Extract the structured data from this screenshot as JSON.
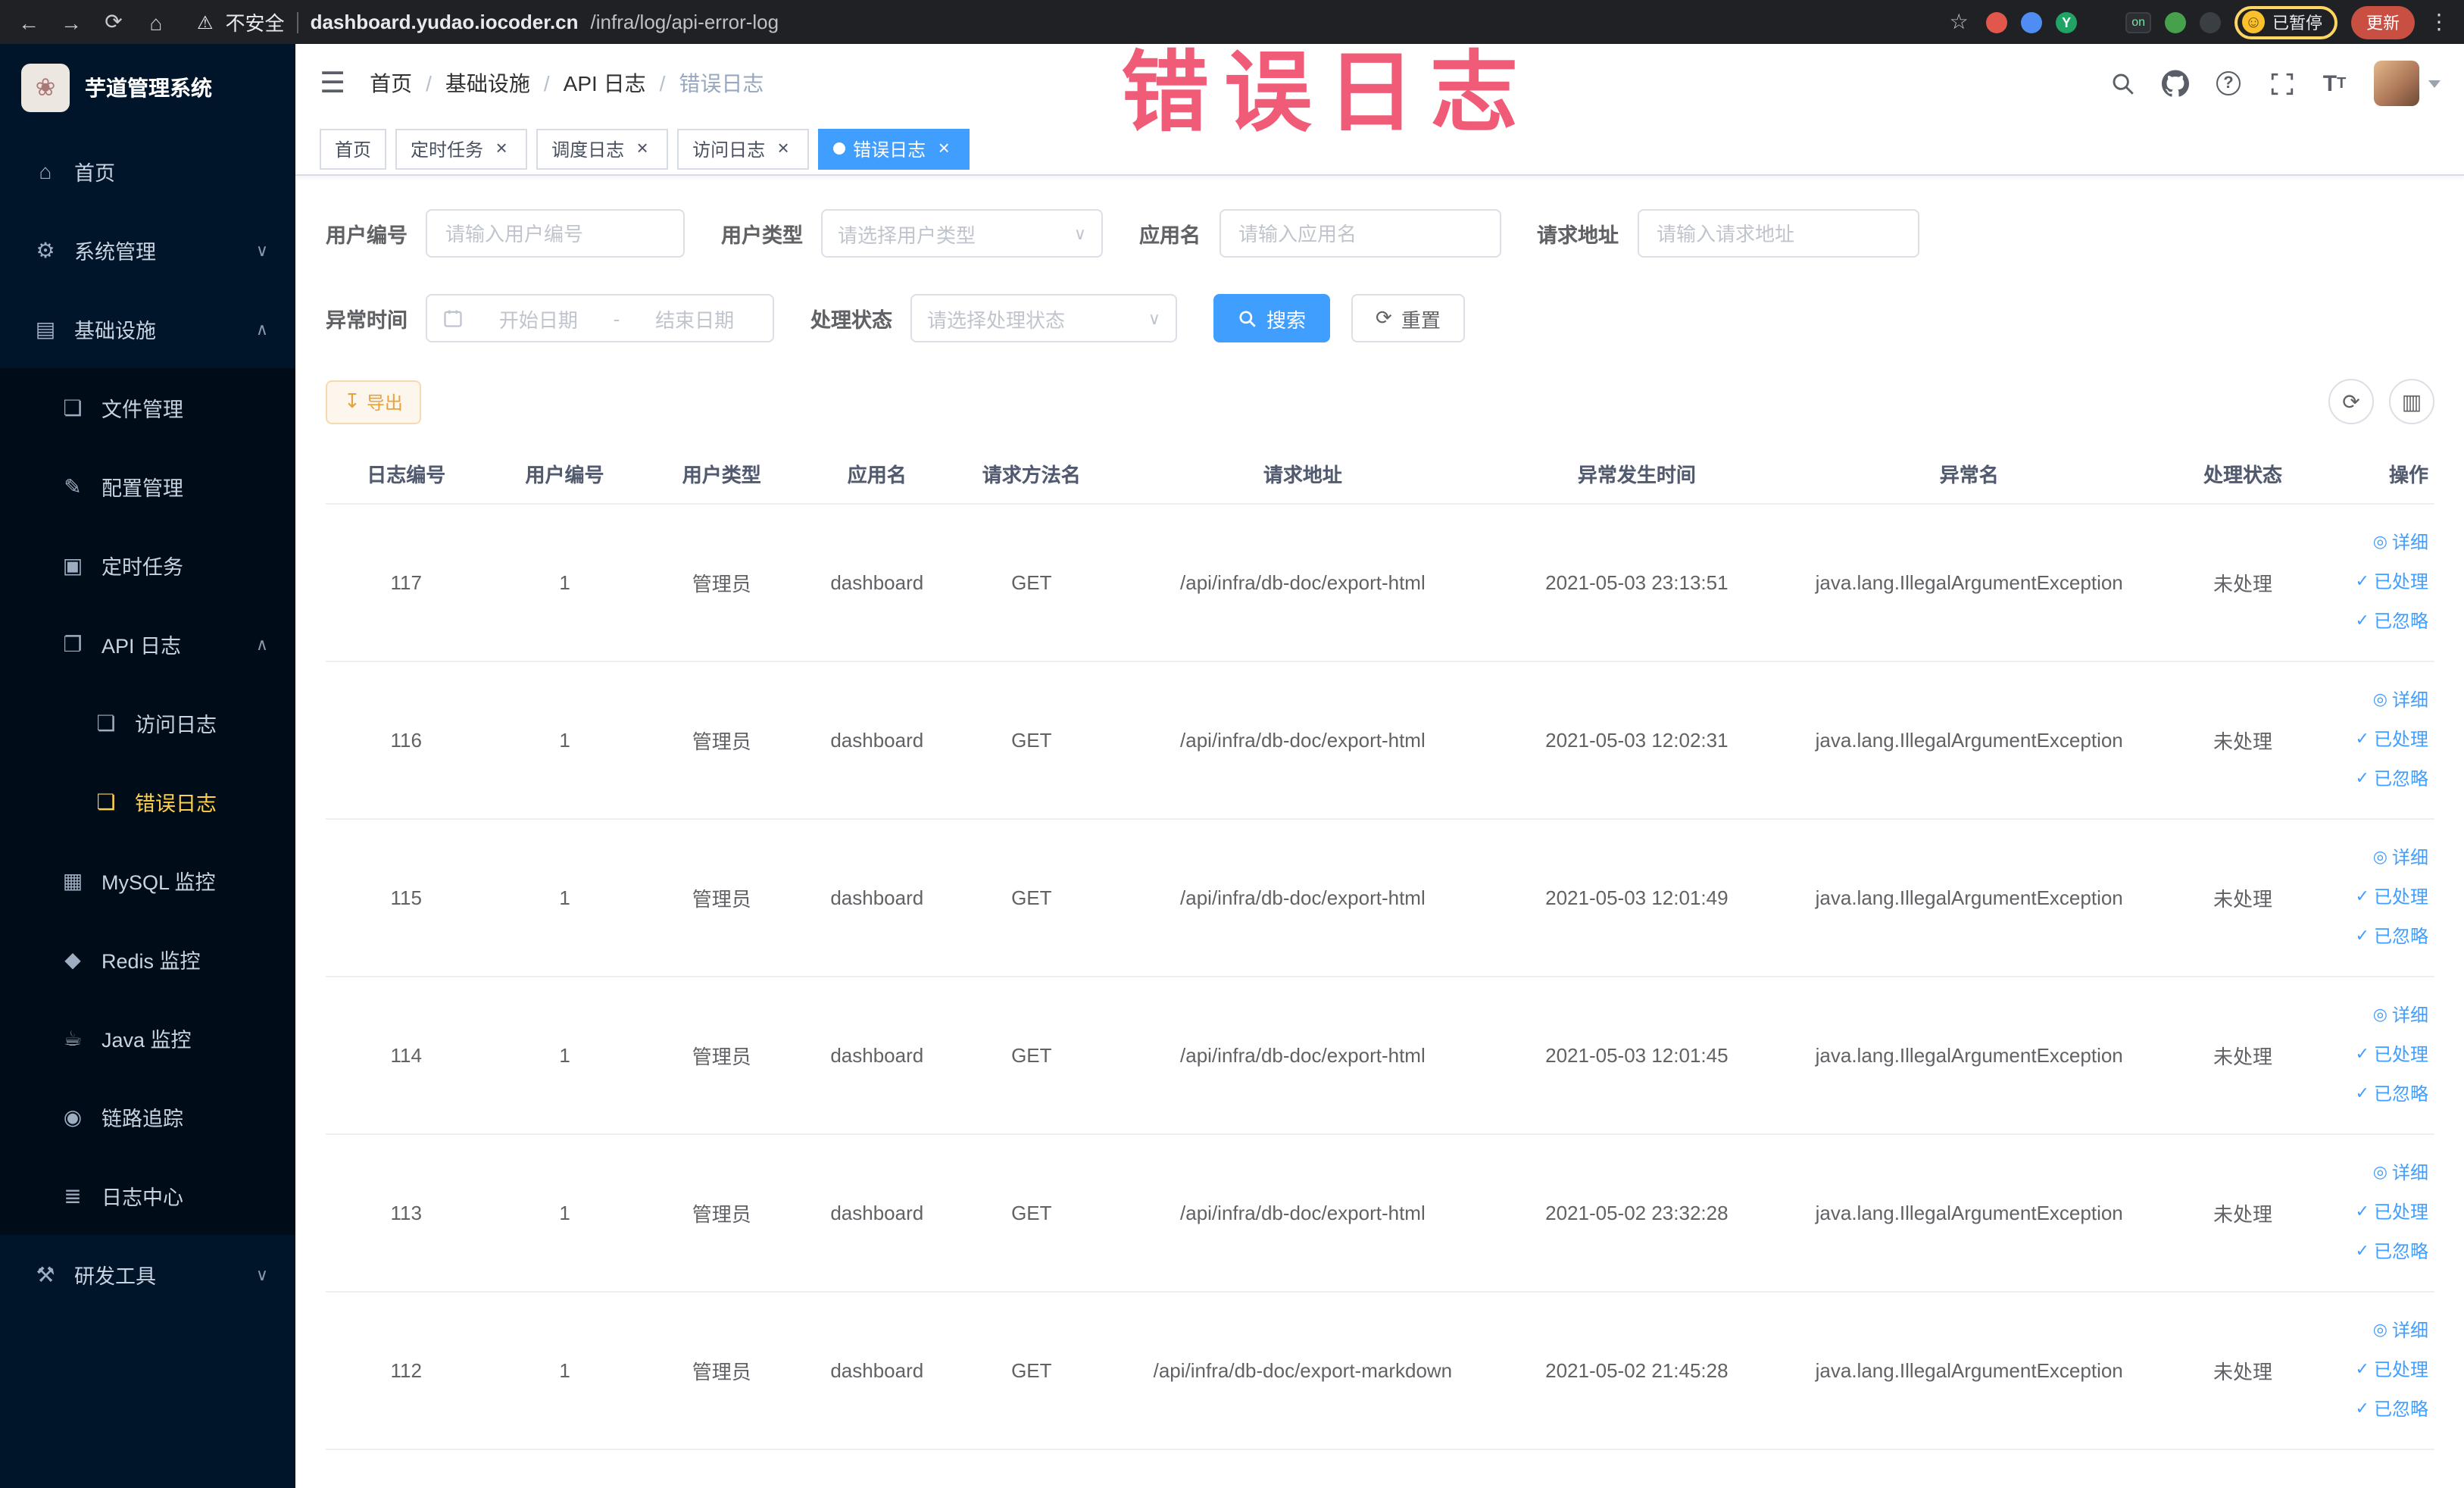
{
  "browser": {
    "security_label": "不安全",
    "url_domain": "dashboard.yudao.iocoder.cn",
    "url_path": "/infra/log/api-error-log",
    "ext_on_badge": "on",
    "profile_badge": "已暂停",
    "update_button": "更新"
  },
  "annotation": {
    "text": "错误日志"
  },
  "sidebar": {
    "logo_title": "芋道管理系统",
    "items": [
      {
        "label": "首页"
      },
      {
        "label": "系统管理"
      },
      {
        "label": "基础设施"
      },
      {
        "label": "文件管理"
      },
      {
        "label": "配置管理"
      },
      {
        "label": "定时任务"
      },
      {
        "label": "API 日志"
      },
      {
        "label": "访问日志"
      },
      {
        "label": "错误日志"
      },
      {
        "label": "MySQL 监控"
      },
      {
        "label": "Redis 监控"
      },
      {
        "label": "Java 监控"
      },
      {
        "label": "链路追踪"
      },
      {
        "label": "日志中心"
      },
      {
        "label": "研发工具"
      }
    ]
  },
  "breadcrumb": {
    "items": [
      "首页",
      "基础设施",
      "API 日志",
      "错误日志"
    ]
  },
  "tabs": [
    {
      "label": "首页"
    },
    {
      "label": "定时任务"
    },
    {
      "label": "调度日志"
    },
    {
      "label": "访问日志"
    },
    {
      "label": "错误日志"
    }
  ],
  "filters": {
    "user_id_label": "用户编号",
    "user_id_placeholder": "请输入用户编号",
    "user_type_label": "用户类型",
    "user_type_placeholder": "请选择用户类型",
    "app_name_label": "应用名",
    "app_name_placeholder": "请输入应用名",
    "request_url_label": "请求地址",
    "request_url_placeholder": "请输入请求地址",
    "exception_time_label": "异常时间",
    "date_start_placeholder": "开始日期",
    "date_separator": "-",
    "date_end_placeholder": "结束日期",
    "process_status_label": "处理状态",
    "process_status_placeholder": "请选择处理状态",
    "search_button": "搜索",
    "reset_button": "重置"
  },
  "toolbar": {
    "export_button": "导出"
  },
  "table": {
    "columns": [
      "日志编号",
      "用户编号",
      "用户类型",
      "应用名",
      "请求方法名",
      "请求地址",
      "异常发生时间",
      "异常名",
      "处理状态",
      "操作"
    ],
    "actions": {
      "detail": "详细",
      "processed": "已处理",
      "ignore": "已忽略"
    },
    "rows": [
      {
        "id": "117",
        "user_id": "1",
        "user_type": "管理员",
        "app": "dashboard",
        "method": "GET",
        "url": "/api/infra/db-doc/export-html",
        "time": "2021-05-03 23:13:51",
        "exception": "java.lang.IllegalArgumentException",
        "status": "未处理"
      },
      {
        "id": "116",
        "user_id": "1",
        "user_type": "管理员",
        "app": "dashboard",
        "method": "GET",
        "url": "/api/infra/db-doc/export-html",
        "time": "2021-05-03 12:02:31",
        "exception": "java.lang.IllegalArgumentException",
        "status": "未处理"
      },
      {
        "id": "115",
        "user_id": "1",
        "user_type": "管理员",
        "app": "dashboard",
        "method": "GET",
        "url": "/api/infra/db-doc/export-html",
        "time": "2021-05-03 12:01:49",
        "exception": "java.lang.IllegalArgumentException",
        "status": "未处理"
      },
      {
        "id": "114",
        "user_id": "1",
        "user_type": "管理员",
        "app": "dashboard",
        "method": "GET",
        "url": "/api/infra/db-doc/export-html",
        "time": "2021-05-03 12:01:45",
        "exception": "java.lang.IllegalArgumentException",
        "status": "未处理"
      },
      {
        "id": "113",
        "user_id": "1",
        "user_type": "管理员",
        "app": "dashboard",
        "method": "GET",
        "url": "/api/infra/db-doc/export-html",
        "time": "2021-05-02 23:32:28",
        "exception": "java.lang.IllegalArgumentException",
        "status": "未处理"
      },
      {
        "id": "112",
        "user_id": "1",
        "user_type": "管理员",
        "app": "dashboard",
        "method": "GET",
        "url": "/api/infra/db-doc/export-markdown",
        "time": "2021-05-02 21:45:28",
        "exception": "java.lang.IllegalArgumentException",
        "status": "未处理"
      }
    ]
  }
}
